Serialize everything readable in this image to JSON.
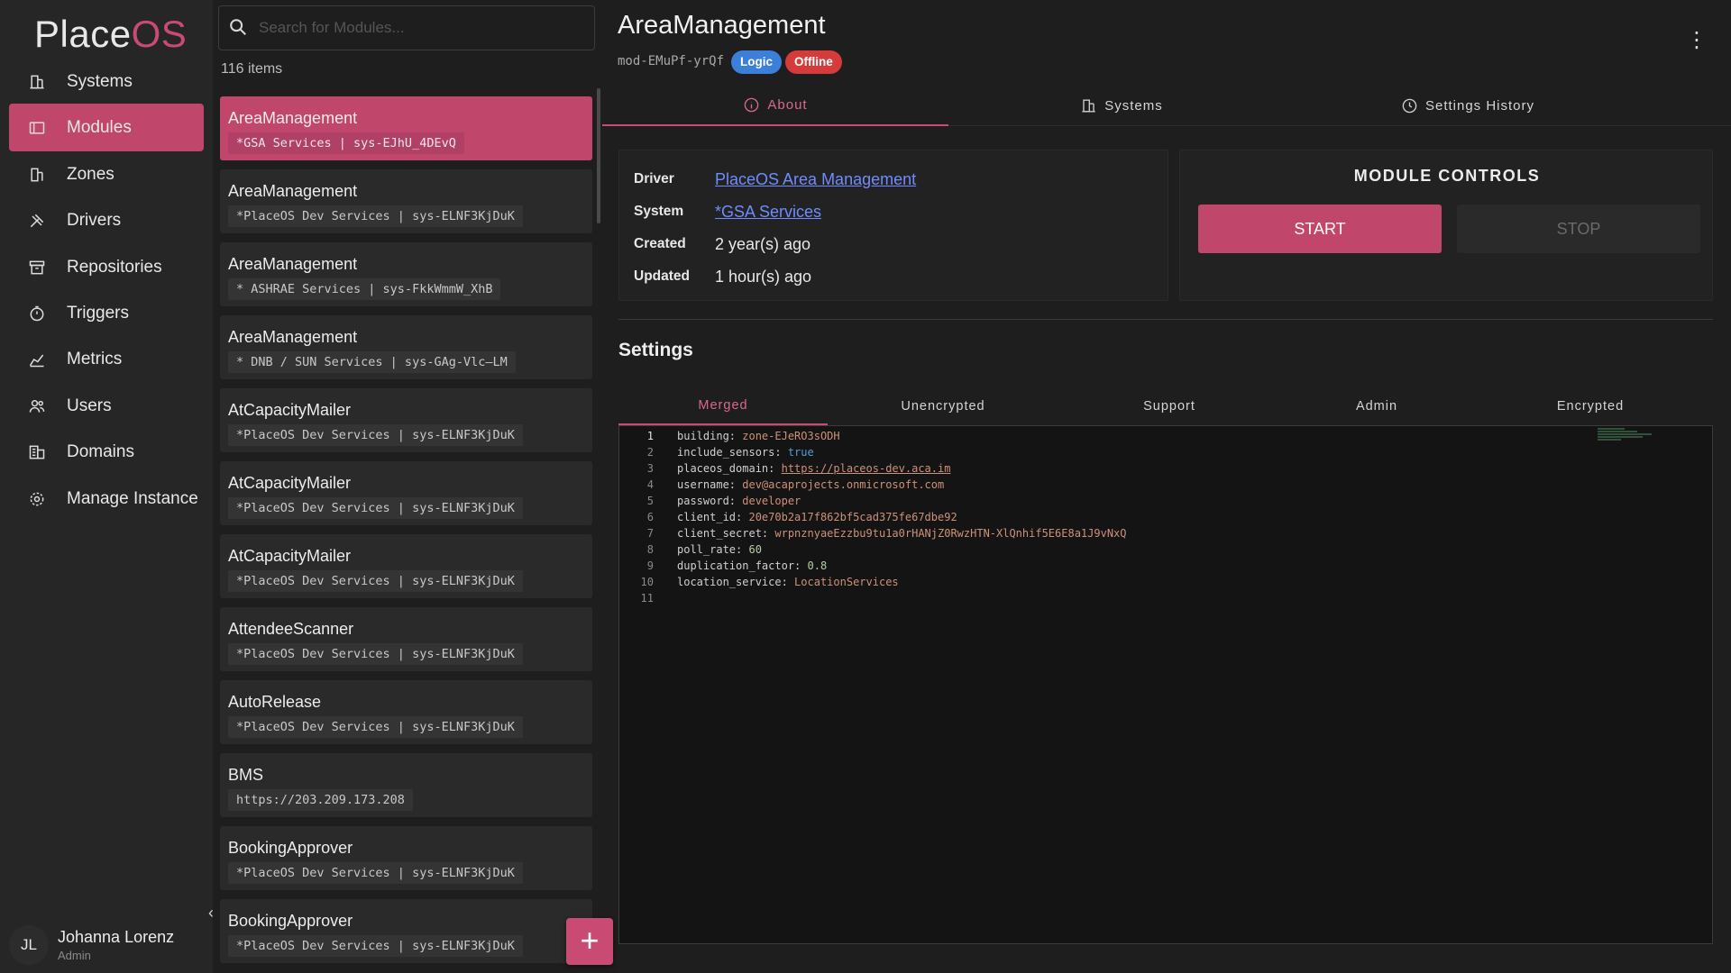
{
  "app": {
    "logo_part1": "Place",
    "logo_part2": "OS"
  },
  "sidebar": {
    "items": [
      {
        "label": "Systems",
        "icon": "building-icon",
        "active": false
      },
      {
        "label": "Modules",
        "icon": "module-icon",
        "active": true
      },
      {
        "label": "Zones",
        "icon": "zones-icon",
        "active": false
      },
      {
        "label": "Drivers",
        "icon": "tools-icon",
        "active": false
      },
      {
        "label": "Repositories",
        "icon": "archive-icon",
        "active": false
      },
      {
        "label": "Triggers",
        "icon": "timer-icon",
        "active": false
      },
      {
        "label": "Metrics",
        "icon": "chart-icon",
        "active": false
      },
      {
        "label": "Users",
        "icon": "users-icon",
        "active": false
      },
      {
        "label": "Domains",
        "icon": "domain-icon",
        "active": false
      },
      {
        "label": "Manage Instance",
        "icon": "gear-icon",
        "active": false
      }
    ],
    "user": {
      "initials": "JL",
      "name": "Johanna Lorenz",
      "role": "Admin"
    }
  },
  "module_list": {
    "search_placeholder": "Search for Modules...",
    "count_label": "116 items",
    "items": [
      {
        "name": "AreaManagement",
        "sub": "*GSA Services | sys-EJhU_4DEvQ",
        "active": true
      },
      {
        "name": "AreaManagement",
        "sub": "*PlaceOS Dev Services | sys-ELNF3KjDuK",
        "active": false
      },
      {
        "name": "AreaManagement",
        "sub": "* ASHRAE Services | sys-FkkWmmW_XhB",
        "active": false
      },
      {
        "name": "AreaManagement",
        "sub": "* DNB / SUN Services | sys-GAg-Vlc—LM",
        "active": false
      },
      {
        "name": "AtCapacityMailer",
        "sub": "*PlaceOS Dev Services | sys-ELNF3KjDuK",
        "active": false
      },
      {
        "name": "AtCapacityMailer",
        "sub": "*PlaceOS Dev Services | sys-ELNF3KjDuK",
        "active": false
      },
      {
        "name": "AtCapacityMailer",
        "sub": "*PlaceOS Dev Services | sys-ELNF3KjDuK",
        "active": false
      },
      {
        "name": "AttendeeScanner",
        "sub": "*PlaceOS Dev Services | sys-ELNF3KjDuK",
        "active": false
      },
      {
        "name": "AutoRelease",
        "sub": "*PlaceOS Dev Services | sys-ELNF3KjDuK",
        "active": false
      },
      {
        "name": "BMS",
        "sub": "https://203.209.173.208",
        "active": false
      },
      {
        "name": "BookingApprover",
        "sub": "*PlaceOS Dev Services | sys-ELNF3KjDuK",
        "active": false
      },
      {
        "name": "BookingApprover",
        "sub": "*PlaceOS Dev Services | sys-ELNF3KjDuK",
        "active": false
      }
    ],
    "add_label": "+"
  },
  "detail": {
    "title": "AreaManagement",
    "module_id": "mod-EMuPf-yrQf",
    "badges": {
      "logic": "Logic",
      "offline": "Offline"
    },
    "badge_colors": {
      "logic": "#3c7fd8",
      "offline": "#d63b3b"
    },
    "tabs": [
      {
        "label": "About",
        "icon": "info-icon",
        "active": true
      },
      {
        "label": "Systems",
        "icon": "building-icon",
        "active": false
      },
      {
        "label": "Settings History",
        "icon": "clock-icon",
        "active": false
      }
    ],
    "about": {
      "driver_label": "Driver",
      "driver_value": "PlaceOS Area Management",
      "system_label": "System",
      "system_value": "*GSA Services",
      "created_label": "Created",
      "created_value": "2 year(s) ago",
      "updated_label": "Updated",
      "updated_value": "1 hour(s) ago"
    },
    "controls": {
      "title": "MODULE CONTROLS",
      "start": "START",
      "stop": "STOP"
    },
    "settings": {
      "title": "Settings",
      "tabs": [
        {
          "label": "Merged",
          "active": true
        },
        {
          "label": "Unencrypted",
          "active": false
        },
        {
          "label": "Support",
          "active": false
        },
        {
          "label": "Admin",
          "active": false
        },
        {
          "label": "Encrypted",
          "active": false
        }
      ],
      "lines": [
        {
          "n": "1",
          "key": "building",
          "value": "zone-EJeRO3sODH",
          "type": "val"
        },
        {
          "n": "2",
          "key": "include_sensors",
          "value": "true",
          "type": "bool"
        },
        {
          "n": "3",
          "key": "placeos_domain",
          "value": "https://placeos-dev.aca.im",
          "type": "link"
        },
        {
          "n": "4",
          "key": "username",
          "value": "dev@acaprojects.onmicrosoft.com",
          "type": "val"
        },
        {
          "n": "5",
          "key": "password",
          "value": "developer",
          "type": "val"
        },
        {
          "n": "6",
          "key": "client_id",
          "value": "20e70b2a17f862bf5cad375fe67dbe92",
          "type": "val"
        },
        {
          "n": "7",
          "key": "client_secret",
          "value": "wrpnznyaeEzzbu9tu1a0rHANjZ0RwzHTN-XlQnhif5E6E8a1J9vNxQ",
          "type": "val"
        },
        {
          "n": "8",
          "key": "poll_rate",
          "value": "60",
          "type": "num"
        },
        {
          "n": "9",
          "key": "duplication_factor",
          "value": "0.8",
          "type": "num"
        },
        {
          "n": "10",
          "key": "location_service",
          "value": "LocationServices",
          "type": "val"
        },
        {
          "n": "11",
          "key": "",
          "value": "",
          "type": "empty"
        }
      ]
    }
  },
  "colors": {
    "accent": "#c1466c",
    "link": "#6f8cff",
    "background": "#1e1e1e"
  }
}
